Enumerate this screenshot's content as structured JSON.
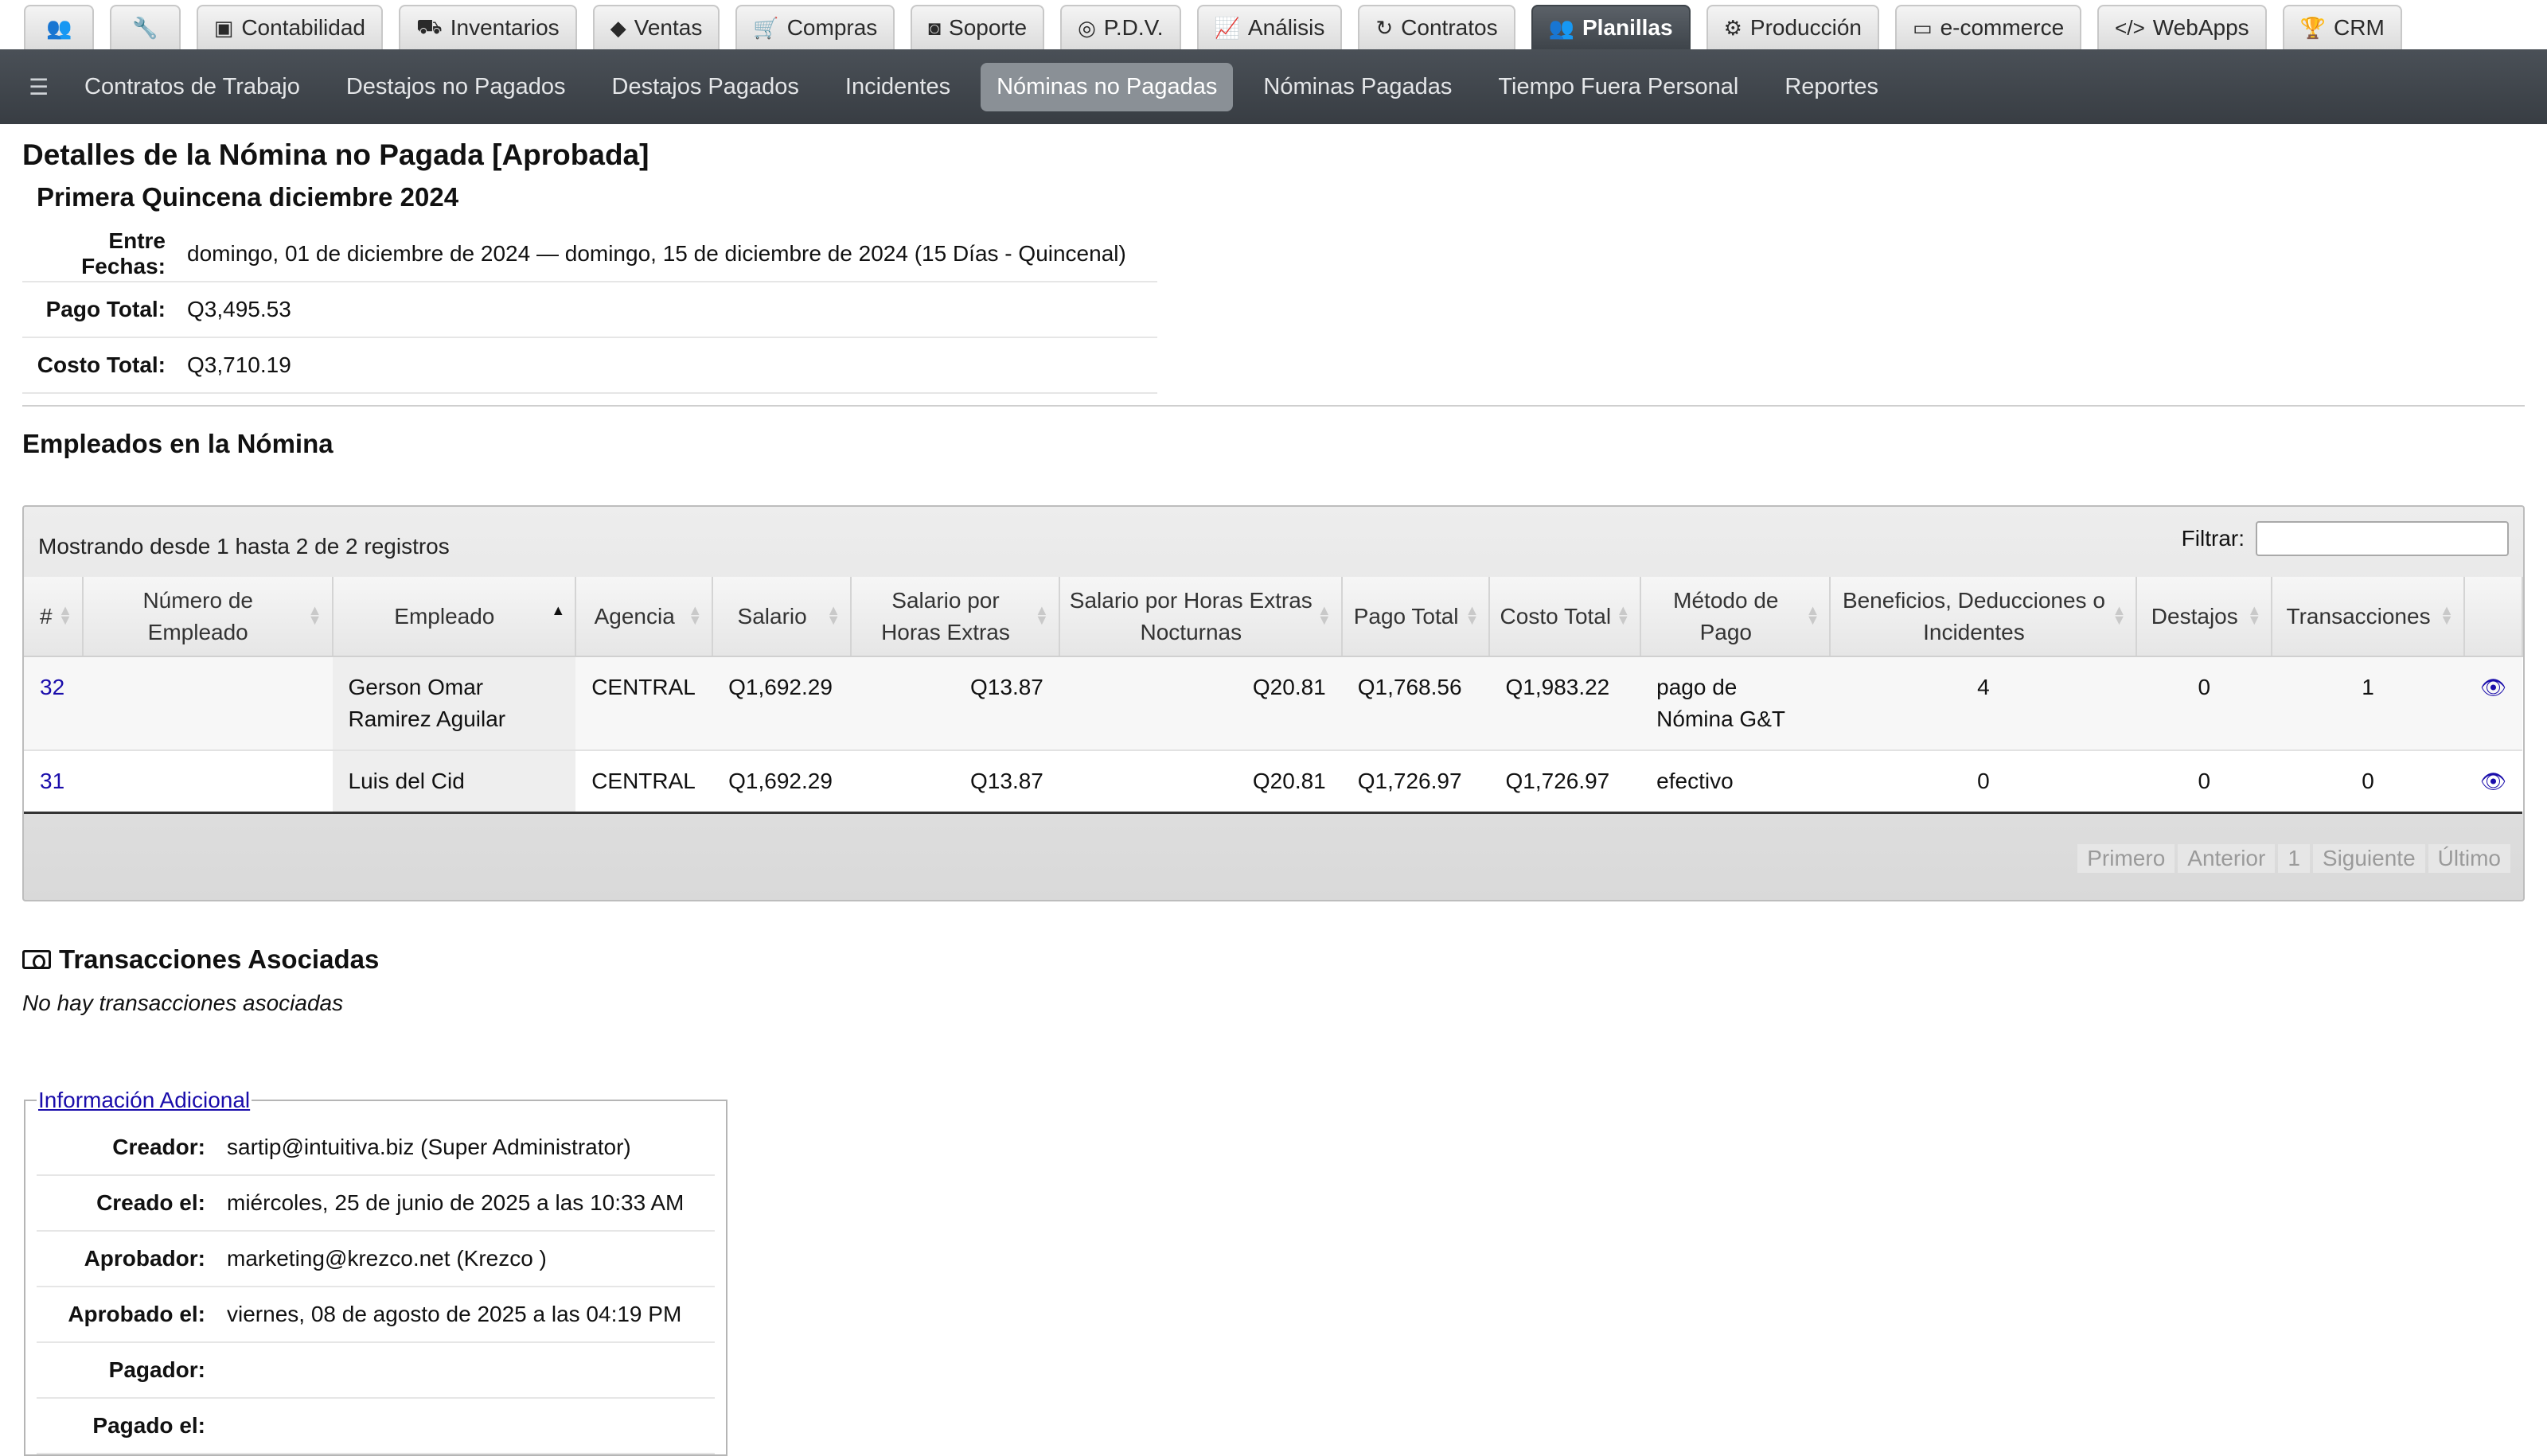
{
  "top_tabs": [
    {
      "label": "",
      "icon": "users-icon",
      "active": false
    },
    {
      "label": "",
      "icon": "wrench-icon",
      "active": false
    },
    {
      "label": "Contabilidad",
      "icon": "money-icon",
      "active": false
    },
    {
      "label": "Inventarios",
      "icon": "truck-icon",
      "active": false
    },
    {
      "label": "Ventas",
      "icon": "tags-icon",
      "active": false
    },
    {
      "label": "Compras",
      "icon": "cart-icon",
      "active": false
    },
    {
      "label": "Soporte",
      "icon": "camera-icon",
      "active": false
    },
    {
      "label": "P.D.V.",
      "icon": "target-icon",
      "active": false
    },
    {
      "label": "Análisis",
      "icon": "chart-line-icon",
      "active": false
    },
    {
      "label": "Contratos",
      "icon": "refresh-icon",
      "active": false
    },
    {
      "label": "Planillas",
      "icon": "users-icon",
      "active": true
    },
    {
      "label": "Producción",
      "icon": "gears-icon",
      "active": false
    },
    {
      "label": "e-commerce",
      "icon": "credit-card-icon",
      "active": false
    },
    {
      "label": "WebApps",
      "icon": "code-icon",
      "active": false
    },
    {
      "label": "CRM",
      "icon": "trophy-icon",
      "active": false
    }
  ],
  "sub_nav": [
    "Contratos de Trabajo",
    "Destajos no Pagados",
    "Destajos Pagados",
    "Incidentes",
    "Nóminas no Pagadas",
    "Nóminas Pagadas",
    "Tiempo Fuera Personal",
    "Reportes"
  ],
  "sub_nav_active": "Nóminas no Pagadas",
  "page": {
    "title": "Detalles de la Nómina no Pagada [Aprobada]",
    "subtitle": "Primera Quincena diciembre 2024"
  },
  "summary": {
    "fechas_label": "Entre Fechas:",
    "fechas_value": "domingo, 01 de diciembre de 2024 — domingo, 15 de diciembre de 2024 (15 Días - Quincenal)",
    "pago_label": "Pago Total:",
    "pago_value": "Q3,495.53",
    "costo_label": "Costo Total:",
    "costo_value": "Q3,710.19"
  },
  "employees": {
    "section_title": "Empleados en la Nómina",
    "info": "Mostrando desde 1 hasta 2 de 2 registros",
    "filter_label": "Filtrar:",
    "filter_value": "",
    "columns": [
      "#",
      "Número de Empleado",
      "Empleado",
      "Agencia",
      "Salario",
      "Salario por Horas Extras",
      "Salario por Horas Extras Nocturnas",
      "Pago Total",
      "Costo Total",
      "Método de Pago",
      "Beneficios, Deducciones o Incidentes",
      "Destajos",
      "Transacciones"
    ],
    "rows": [
      {
        "id": "32",
        "numero": "",
        "empleado": "Gerson Omar Ramirez Aguilar",
        "agencia": "CENTRAL",
        "salario": "Q1,692.29",
        "extras": "Q13.87",
        "nocturnas": "Q20.81",
        "pago": "Q1,768.56",
        "costo": "Q1,983.22",
        "metodo": "pago de Nómina G&T",
        "beneficios": "4",
        "destajos": "0",
        "transacciones": "1"
      },
      {
        "id": "31",
        "numero": "",
        "empleado": "Luis del Cid",
        "agencia": "CENTRAL",
        "salario": "Q1,692.29",
        "extras": "Q13.87",
        "nocturnas": "Q20.81",
        "pago": "Q1,726.97",
        "costo": "Q1,726.97",
        "metodo": "efectivo",
        "beneficios": "0",
        "destajos": "0",
        "transacciones": "0"
      }
    ],
    "pager": [
      "Primero",
      "Anterior",
      "1",
      "Siguiente",
      "Último"
    ]
  },
  "transactions": {
    "title": "Transacciones Asociadas",
    "empty": "No hay transacciones asociadas"
  },
  "extra_info": {
    "legend": "Información Adicional",
    "rows": [
      {
        "label": "Creador:",
        "value": "sartip@intuitiva.biz (Super Administrator)"
      },
      {
        "label": "Creado el:",
        "value": "miércoles, 25 de junio de 2025 a las 10:33 AM"
      },
      {
        "label": "Aprobador:",
        "value": "marketing@krezco.net (Krezco )"
      },
      {
        "label": "Aprobado el:",
        "value": "viernes, 08 de agosto de 2025 a las 04:19 PM"
      },
      {
        "label": "Pagador:",
        "value": ""
      },
      {
        "label": "Pagado el:",
        "value": ""
      }
    ]
  }
}
